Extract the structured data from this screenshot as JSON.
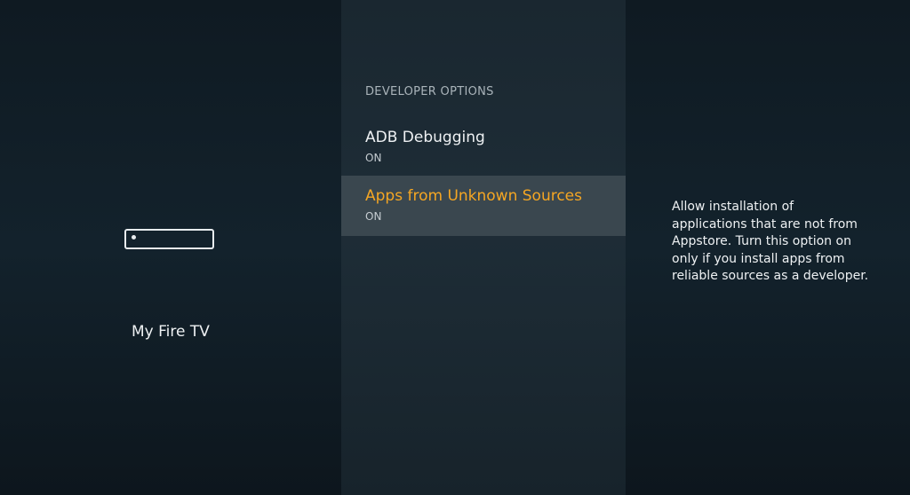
{
  "device": {
    "icon": "fire-tv-stick-icon",
    "label": "My Fire TV"
  },
  "developer_options": {
    "header": "DEVELOPER OPTIONS",
    "items": [
      {
        "title": "ADB Debugging",
        "status": "ON",
        "selected": false
      },
      {
        "title": "Apps from Unknown Sources",
        "status": "ON",
        "selected": true
      }
    ]
  },
  "description": "Allow installation of applications that are not from Appstore. Turn this option on only if you install apps from reliable sources as a developer.",
  "colors": {
    "accent": "#f5a623",
    "selected_bg": "#3a474f",
    "text": "#eef1f3"
  }
}
